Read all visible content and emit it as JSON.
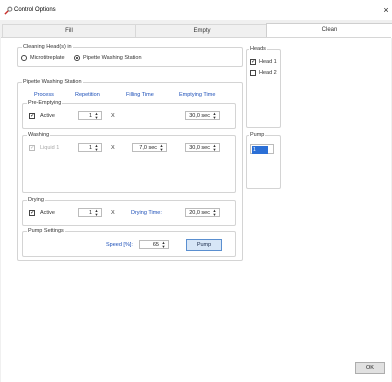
{
  "window": {
    "title": "Control Options",
    "close_glyph": "×"
  },
  "tabs": [
    {
      "label": "Fill",
      "active": false
    },
    {
      "label": "Empty",
      "active": false
    },
    {
      "label": "Clean",
      "active": true
    }
  ],
  "cleaning_heads": {
    "title": "Cleaning Head(s) in",
    "options": [
      {
        "label": "Microtitreplate",
        "selected": false
      },
      {
        "label": "Pipette Washing Station",
        "selected": true
      }
    ]
  },
  "pipette_washing_station": {
    "title": "Pipette Washing Station",
    "headers": {
      "process": "Process",
      "repetition": "Repetition",
      "filling": "Filling Time",
      "emptying": "Emptying Time"
    },
    "pre_emptying": {
      "title": "Pre-Emptying",
      "active_label": "Active",
      "repetition": "1",
      "times": "X",
      "emptying_time": "30,0 sec"
    },
    "washing": {
      "title": "Washing",
      "liquid_label": "Liquid 1",
      "repetition": "1",
      "times": "X",
      "filling_time": "7,0 sec",
      "emptying_time": "30,0 sec"
    },
    "drying": {
      "title": "Drying",
      "active_label": "Active",
      "repetition": "1",
      "times": "X",
      "drying_time_label": "Drying Time:",
      "drying_time": "20,0 sec"
    },
    "pump_settings": {
      "title": "Pump Settings",
      "speed_label": "Speed [%]:",
      "speed": "65",
      "pump_button": "Pump"
    }
  },
  "heads": {
    "title": "Heads",
    "items": [
      {
        "label": "Head 1",
        "checked": true
      },
      {
        "label": "Head 2",
        "checked": false
      }
    ]
  },
  "pump": {
    "title": "Pump",
    "selected": "1"
  },
  "footer": {
    "ok_label": "OK"
  },
  "icons": {
    "app": "wrench-icon",
    "close": "close-icon",
    "spin": "spin-arrows-icon"
  },
  "colors": {
    "accent_blue": "#1c4fb8",
    "selection": "#2b6fd6",
    "button_blue": "#d7e6f7"
  }
}
